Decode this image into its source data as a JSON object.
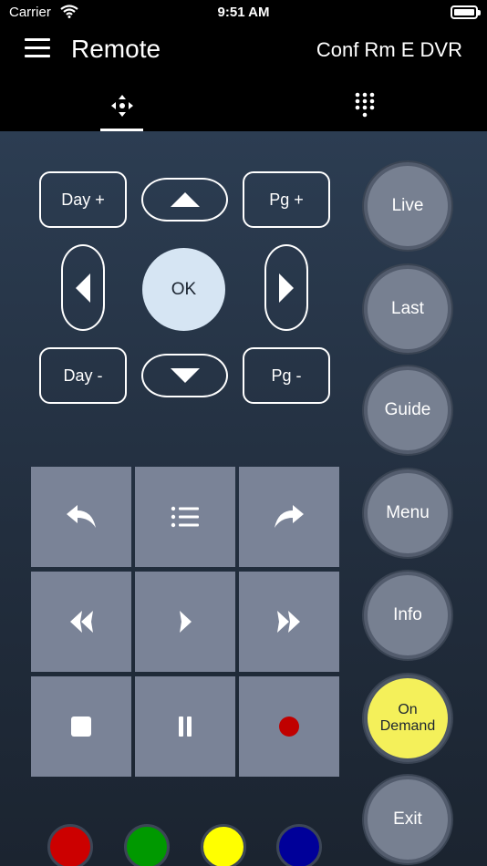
{
  "status_bar": {
    "carrier": "Carrier",
    "time": "9:51 AM"
  },
  "nav": {
    "title": "Remote",
    "device": "Conf Rm E  DVR"
  },
  "tabs": [
    {
      "name": "dpad",
      "icon": "dpad-icon",
      "selected": true
    },
    {
      "name": "keypad",
      "icon": "keypad-icon",
      "selected": false
    }
  ],
  "dpad": {
    "day_plus": "Day +",
    "page_plus": "Pg +",
    "day_minus": "Day -",
    "page_minus": "Pg -",
    "ok": "OK"
  },
  "transport_icons": [
    "back-icon",
    "list-icon",
    "forward-icon",
    "rewind-icon",
    "play-icon",
    "fast-forward-icon",
    "stop-icon",
    "pause-icon",
    "record-icon"
  ],
  "side_buttons": {
    "live": "Live",
    "last": "Last",
    "guide": "Guide",
    "menu": "Menu",
    "info": "Info",
    "on_demand_line1": "On",
    "on_demand_line2": "Demand",
    "exit": "Exit"
  },
  "colors": {
    "accent_ok": "#d6e5f3",
    "on_demand": "#f4f05a",
    "record": "#c00000",
    "color_buttons": [
      "#cc0000",
      "#009900",
      "#ffff00",
      "#000099"
    ]
  }
}
